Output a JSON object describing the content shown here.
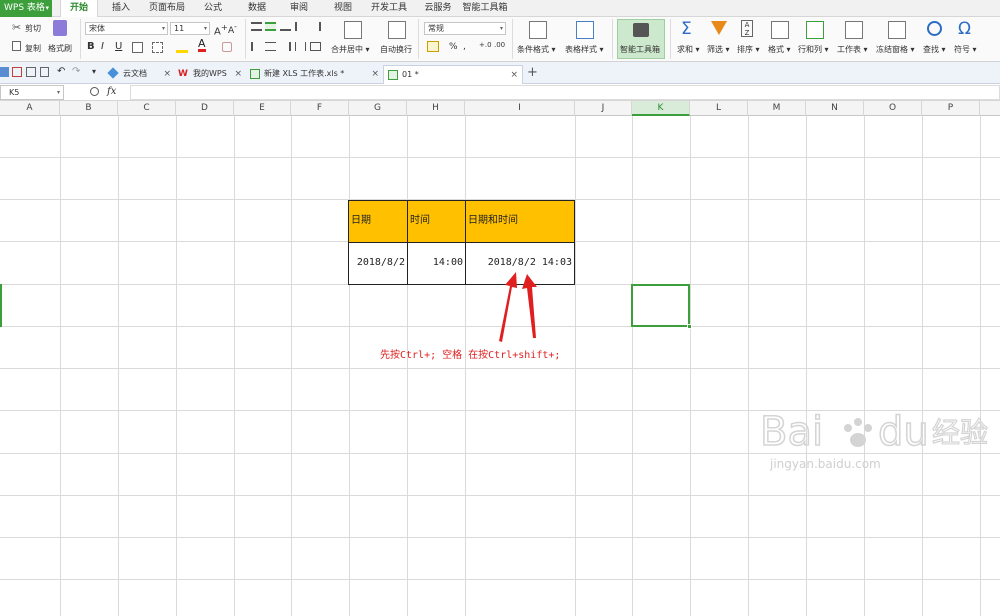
{
  "app": {
    "name": "WPS 表格"
  },
  "menu_tabs": [
    "开始",
    "插入",
    "页面布局",
    "公式",
    "数据",
    "审阅",
    "视图",
    "开发工具",
    "云服务",
    "智能工具箱"
  ],
  "active_menu_tab": "开始",
  "ribbon": {
    "cut": "剪切",
    "copy": "复制",
    "format_painter": "格式刷",
    "font_name": "宋体",
    "font_size": "11",
    "number_format": "常规",
    "merge_center": "合并居中",
    "wrap_text": "自动换行",
    "conditional_format": "条件格式",
    "table_style": "表格样式",
    "smart_toolbox": "智能工具箱",
    "sum": "求和",
    "filter": "筛选",
    "sort": "排序",
    "format": "格式",
    "rows_cols": "行和列",
    "worksheet": "工作表",
    "freeze": "冻结窗格",
    "find": "查找",
    "symbol": "符号",
    "bold": "B",
    "italic": "I",
    "underline": "U",
    "percent": "%",
    "comma": ",",
    "symbol_omega": "Ω",
    "sum_sigma": "Σ"
  },
  "doc_tabs": [
    {
      "label": "云文档",
      "closable": true
    },
    {
      "label": "我的WPS",
      "closable": true
    },
    {
      "label": "新建 XLS 工作表.xls *",
      "closable": true
    },
    {
      "label": "01 *",
      "closable": true,
      "active": true
    }
  ],
  "formula_bar": {
    "name_box": "K5",
    "fx": "fx",
    "value": ""
  },
  "columns": [
    "A",
    "B",
    "C",
    "D",
    "E",
    "F",
    "G",
    "H",
    "I",
    "J",
    "K",
    "L",
    "M",
    "N",
    "O",
    "P"
  ],
  "active_column": "K",
  "table": {
    "headers": [
      "日期",
      "时间",
      "日期和时间"
    ],
    "row": [
      "2018/8/2",
      "14:00",
      "2018/8/2 14:03"
    ]
  },
  "annotation": "先按Ctrl+;  空格  在按Ctrl+shift+;",
  "watermark": {
    "text": "jingyan.baidu.com",
    "logo": "Bai du 经验"
  },
  "colors": {
    "accent_green": "#3c9f3c",
    "header_fill": "#ffc000",
    "annotation_red": "#e02020"
  }
}
